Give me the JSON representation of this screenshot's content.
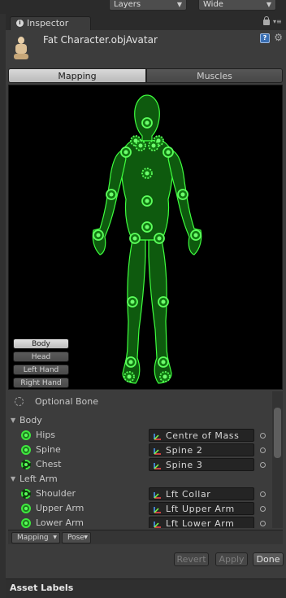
{
  "top": {
    "layers_label": "Layers",
    "layout_label": "Wide"
  },
  "inspector": {
    "tab_label": "Inspector",
    "title": "Fat Character.objAvatar"
  },
  "mode_tabs": {
    "mapping": "Mapping",
    "muscles": "Muscles",
    "selected": "Mapping"
  },
  "body_parts": {
    "buttons": [
      "Body",
      "Head",
      "Left Hand",
      "Right Hand"
    ],
    "selected": "Body"
  },
  "bone_list": {
    "optional_label": "Optional Bone",
    "sections": [
      {
        "label": "Body",
        "bones": [
          {
            "name": "Hips",
            "target": "Centre of Mass",
            "optional": false
          },
          {
            "name": "Spine",
            "target": "Spine 2",
            "optional": false
          },
          {
            "name": "Chest",
            "target": "Spine 3",
            "optional": true
          }
        ]
      },
      {
        "label": "Left Arm",
        "bones": [
          {
            "name": "Shoulder",
            "target": "Lft Collar",
            "optional": true
          },
          {
            "name": "Upper Arm",
            "target": "Lft Upper Arm",
            "optional": false
          },
          {
            "name": "Lower Arm",
            "target": "Lft Lower Arm",
            "optional": false
          }
        ]
      }
    ]
  },
  "bottom_toolbar": {
    "mapping_menu": "Mapping",
    "pose_menu": "Pose"
  },
  "actions": {
    "revert": "Revert",
    "apply": "Apply",
    "done": "Done"
  },
  "footer": {
    "asset_labels": "Asset Labels"
  },
  "colors": {
    "bone_green": "#3ee83e",
    "background": "#3c3c3c",
    "view_bg": "#000000"
  }
}
